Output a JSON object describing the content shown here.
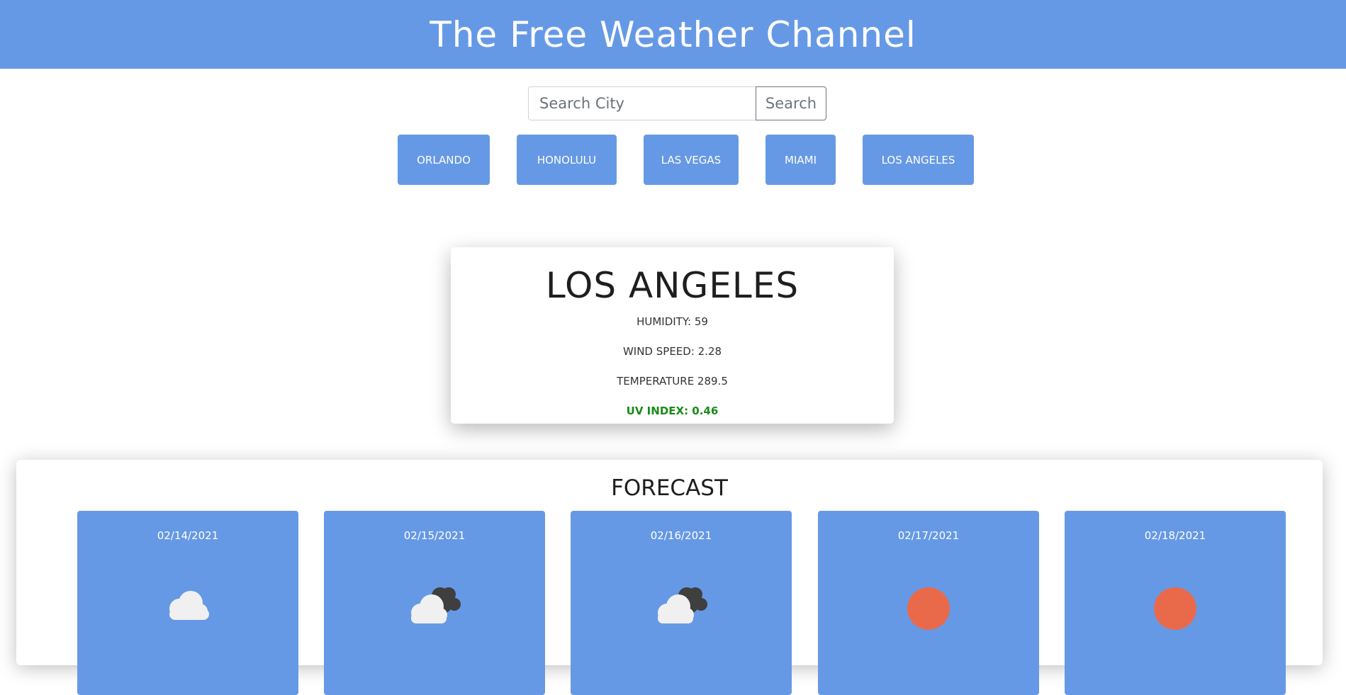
{
  "app": {
    "title": "The Free Weather Channel"
  },
  "search": {
    "placeholder": "Search City",
    "value": "",
    "button_label": "Search"
  },
  "cities": [
    {
      "label": "ORLANDO"
    },
    {
      "label": "HONOLULU"
    },
    {
      "label": "LAS VEGAS"
    },
    {
      "label": "MIAMI"
    },
    {
      "label": "LOS ANGELES"
    }
  ],
  "current": {
    "city": "LOS ANGELES",
    "humidity": "HUMIDITY: 59",
    "wind_speed": "WIND SPEED: 2.28",
    "temperature": "TEMPERATURE 289.5",
    "uv_index": "UV INDEX: 0.46",
    "uv_color": "#1a8a1a"
  },
  "forecast": {
    "title": "FORECAST",
    "days": [
      {
        "date": "02/14/2021",
        "icon": "cloud-icon"
      },
      {
        "date": "02/15/2021",
        "icon": "partly-cloudy-dark-icon"
      },
      {
        "date": "02/16/2021",
        "icon": "partly-cloudy-dark-icon"
      },
      {
        "date": "02/17/2021",
        "icon": "sun-icon"
      },
      {
        "date": "02/18/2021",
        "icon": "sun-icon"
      }
    ]
  },
  "colors": {
    "primary": "#6699e5",
    "sun": "#e96a4b",
    "cloud": "#f0f0f0",
    "dark_cloud": "#3f3f3f"
  }
}
